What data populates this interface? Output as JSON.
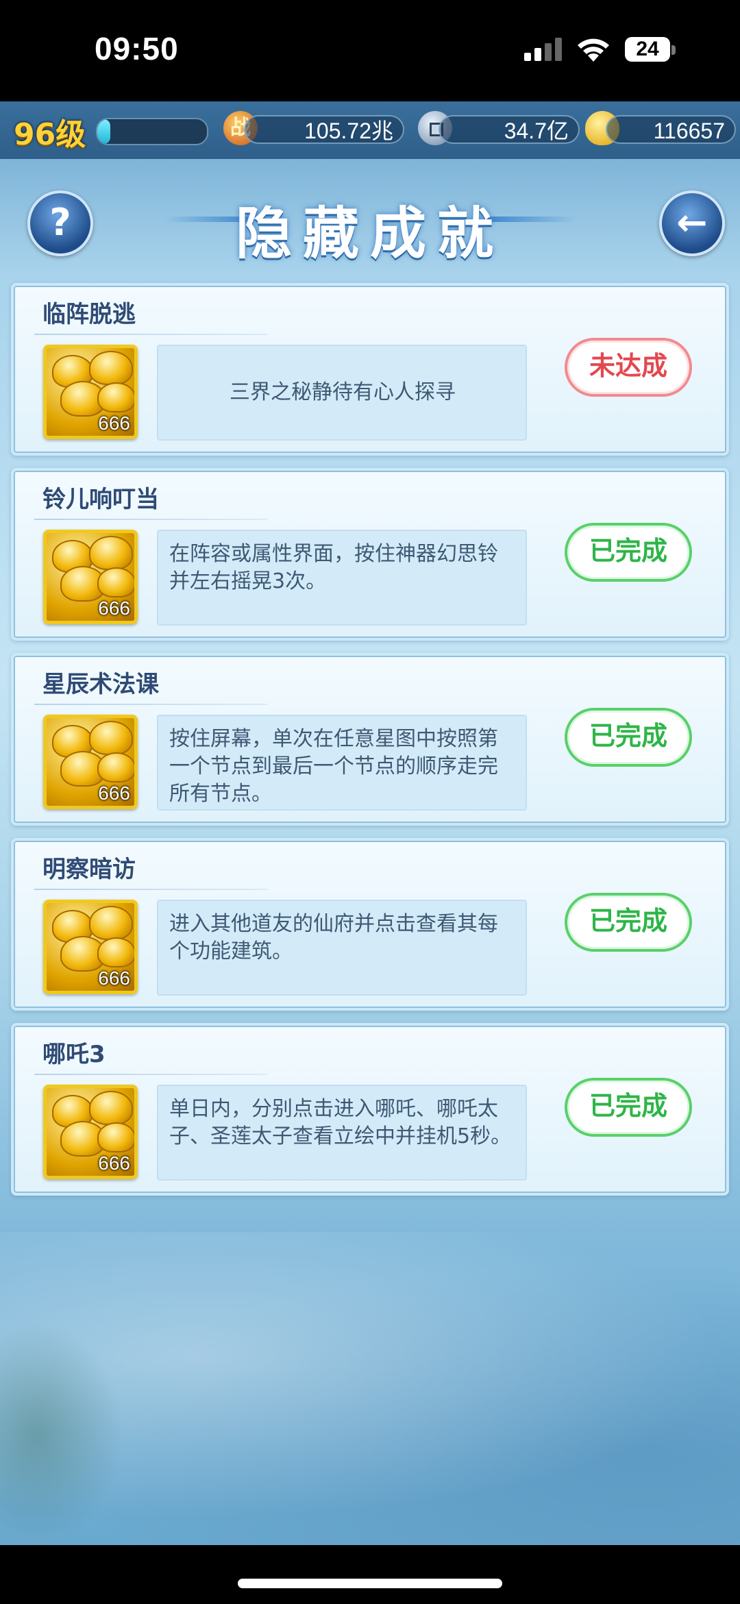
{
  "status_bar": {
    "time": "09:50",
    "battery": "24"
  },
  "top_bar": {
    "level": "96级",
    "exp_fraction": 0.12,
    "power_icon_glyph": "战",
    "power": "105.72兆",
    "silver": "34.7亿",
    "gold": "116657"
  },
  "header": {
    "title": "隐藏成就",
    "help_glyph": "?",
    "back_glyph": "←"
  },
  "achievements": [
    {
      "name": "临阵脱逃",
      "reward_count": "666",
      "description": "三界之秘静待有心人探寻",
      "status": "未达成",
      "state": "pending"
    },
    {
      "name": "铃儿响叮当",
      "reward_count": "666",
      "description": "在阵容或属性界面，按住神器幻思铃并左右摇晃3次。",
      "status": "已完成",
      "state": "done"
    },
    {
      "name": "星辰术法课",
      "reward_count": "666",
      "description": "按住屏幕，单次在任意星图中按照第一个节点到最后一个节点的顺序走完所有节点。",
      "status": "已完成",
      "state": "done"
    },
    {
      "name": "明察暗访",
      "reward_count": "666",
      "description": "进入其他道友的仙府并点击查看其每个功能建筑。",
      "status": "已完成",
      "state": "done"
    },
    {
      "name": "哪吒3",
      "reward_count": "666",
      "description": "单日内，分别点击进入哪吒、哪吒太子、圣莲太子查看立绘中并挂机5秒。",
      "status": "已完成",
      "state": "done"
    }
  ],
  "colors": {
    "pending": "#e3484f",
    "done": "#2eb548",
    "level_text": "#ffd23a",
    "card_title": "#2f4a75"
  }
}
